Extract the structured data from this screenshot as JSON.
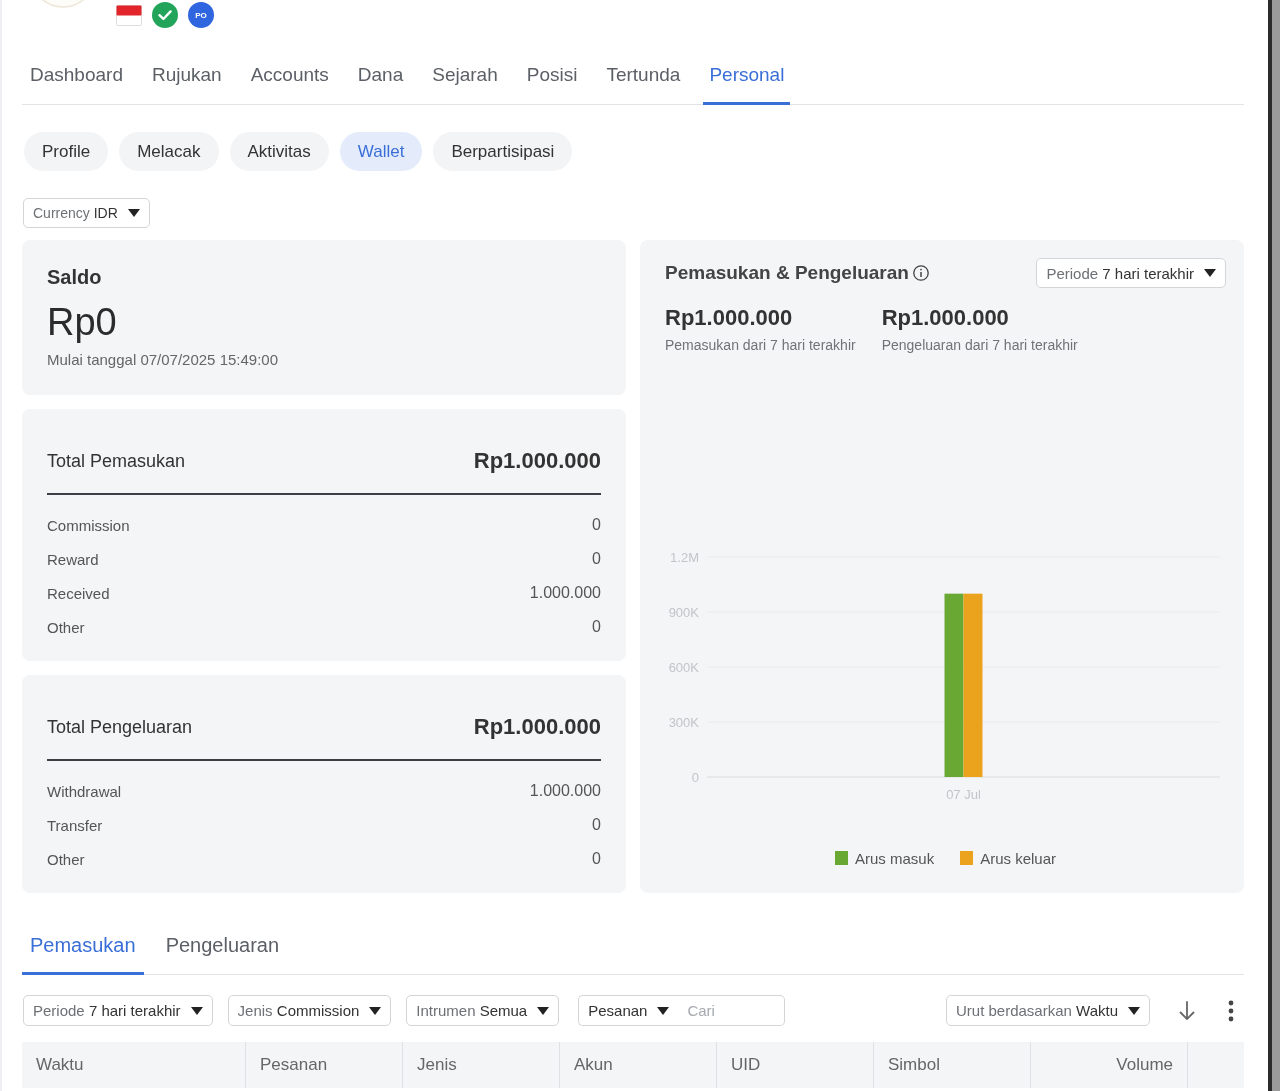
{
  "profile": {
    "badges": [
      {
        "kind": "flag"
      },
      {
        "kind": "verified"
      },
      {
        "kind": "initials",
        "text": "PO"
      }
    ]
  },
  "nav_tabs": [
    {
      "label": "Dashboard",
      "selected": false
    },
    {
      "label": "Rujukan",
      "selected": false
    },
    {
      "label": "Accounts",
      "selected": false
    },
    {
      "label": "Dana",
      "selected": false
    },
    {
      "label": "Sejarah",
      "selected": false
    },
    {
      "label": "Posisi",
      "selected": false
    },
    {
      "label": "Tertunda",
      "selected": false
    },
    {
      "label": "Personal",
      "selected": true
    }
  ],
  "sub_tabs": [
    {
      "label": "Profile",
      "selected": false
    },
    {
      "label": "Melacak",
      "selected": false
    },
    {
      "label": "Aktivitas",
      "selected": false
    },
    {
      "label": "Wallet",
      "selected": true
    },
    {
      "label": "Berpartisipasi",
      "selected": false
    }
  ],
  "currency_select": {
    "label": "Currency",
    "value": "IDR"
  },
  "balance_card": {
    "title": "Saldo",
    "amount": "Rp0",
    "since": "Mulai tanggal 07/07/2025 15:49:00"
  },
  "income_card": {
    "title": "Total Pemasukan",
    "total": "Rp1.000.000",
    "rows": [
      {
        "label": "Commission",
        "value": "0"
      },
      {
        "label": "Reward",
        "value": "0"
      },
      {
        "label": "Received",
        "value": "1.000.000"
      },
      {
        "label": "Other",
        "value": "0"
      }
    ]
  },
  "expense_card": {
    "title": "Total Pengeluaran",
    "total": "Rp1.000.000",
    "rows": [
      {
        "label": "Withdrawal",
        "value": "1.000.000"
      },
      {
        "label": "Transfer",
        "value": "0"
      },
      {
        "label": "Other",
        "value": "0"
      }
    ]
  },
  "chart_card": {
    "title": "Pemasukan & Pengeluaran",
    "period_select": {
      "label": "Periode",
      "value": "7 hari terakhir"
    },
    "summaries": [
      {
        "amount": "Rp1.000.000",
        "caption": "Pemasukan dari 7 hari terakhir"
      },
      {
        "amount": "Rp1.000.000",
        "caption": "Pengeluaran dari 7 hari terakhir"
      }
    ],
    "chart_data": {
      "type": "bar",
      "categories": [
        "07 Jul"
      ],
      "series": [
        {
          "name": "Arus masuk",
          "color": "#6aa834",
          "values": [
            1000000
          ]
        },
        {
          "name": "Arus keluar",
          "color": "#eba21c",
          "values": [
            1000000
          ]
        }
      ],
      "ylim": [
        0,
        1200000
      ],
      "yticks": [
        {
          "value": 0,
          "label": "0"
        },
        {
          "value": 300000,
          "label": "300K"
        },
        {
          "value": 600000,
          "label": "600K"
        },
        {
          "value": 900000,
          "label": "900K"
        },
        {
          "value": 1200000,
          "label": "1.2M"
        }
      ],
      "grid": true,
      "legend": true
    }
  },
  "list_tabs": [
    {
      "label": "Pemasukan",
      "selected": true
    },
    {
      "label": "Pengeluaran",
      "selected": false
    }
  ],
  "filters": [
    {
      "label": "Periode",
      "value": "7 hari terakhir"
    },
    {
      "label": "Jenis",
      "value": "Commission"
    },
    {
      "label": "Intrumen",
      "value": "Semua"
    }
  ],
  "search": {
    "type_select": "Pesanan",
    "placeholder": "Cari"
  },
  "sort_select": {
    "label": "Urut berdasarkan",
    "value": "Waktu"
  },
  "table": {
    "columns": [
      {
        "label": "Waktu",
        "kind": "text"
      },
      {
        "label": "Pesanan",
        "kind": "text"
      },
      {
        "label": "Jenis",
        "kind": "text"
      },
      {
        "label": "Akun",
        "kind": "text"
      },
      {
        "label": "UID",
        "kind": "text"
      },
      {
        "label": "Simbol",
        "kind": "text"
      },
      {
        "label": "Volume",
        "kind": "number"
      }
    ]
  }
}
